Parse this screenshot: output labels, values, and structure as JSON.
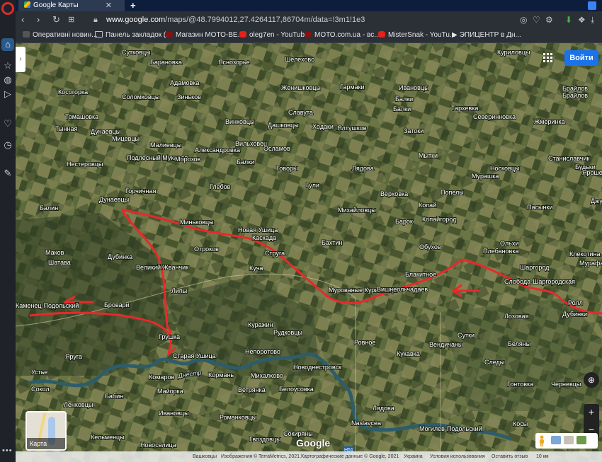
{
  "browser": {
    "tab_title": "Google Карты",
    "url_host": "www.google.com",
    "url_path": "/maps/@48.7994012,27.4264117,86704m/data=!3m1!1e3",
    "bookmarks": [
      {
        "label": "Оперативні новин...",
        "icon": "um"
      },
      {
        "label": "Панель закладок (...",
        "icon": "folder"
      },
      {
        "label": "Магазин МОТО-ВЕ...",
        "icon": "moto"
      },
      {
        "label": "oleg7en - YouTube",
        "icon": "yt"
      },
      {
        "label": "МОТО.com.ua - вс...",
        "icon": "moto"
      },
      {
        "label": "MisterSnak - YouTu...",
        "icon": "yt"
      },
      {
        "label": "ЭПИЦЕНТР в Дн...",
        "icon": "play"
      }
    ]
  },
  "map": {
    "signin_label": "Войти",
    "layers_label": "Карта",
    "google_logo": "Google",
    "places": [
      "Сутковцы",
      "Барановка",
      "Ясноз... ",
      "Шелехово",
      "Куриловцы",
      "Яснозорье",
      "Косогорка",
      "Адамовка",
      "Соломковцы",
      "Зиньков",
      "Гармаки",
      "Ивановцы",
      "Брайлов",
      "Томашовка",
      "Женишковцы",
      "Балки",
      "Тархевка",
      "Северинновка",
      "Брайлов",
      "Тынная",
      "Дунаевцы",
      "Винковцы",
      "Славута",
      "Ходаки",
      "Балки",
      "Затоки",
      "Жмеринка",
      "Мицевцы",
      "Малиевцы",
      "Дашковцы",
      "Ялтушков",
      "Станиславчик",
      "Нестеровцы",
      "Подлесный Мукаров",
      "Вильховец",
      "Александровка",
      "Осламов",
      "Мытки",
      "Будьки",
      "Морозов",
      "Балки",
      "Говоры",
      "Лядова",
      "Носковцы",
      "Ярошевка",
      "Горчичная",
      "Глебов",
      "Гули",
      "Мурашка",
      "Джурин",
      "Балин",
      "Дунаевцы",
      "Верховка",
      "Попелы",
      "Пасынки",
      "Миньковцы",
      "Михайловцы",
      "Копай",
      "Копайгород",
      "Новая Ушица",
      "Барок",
      "Каскада",
      "Бахтин",
      "Ольхи",
      "Плебановка",
      "Маков",
      "Отроков",
      "Струга",
      "Обухов",
      "Клекотина",
      "Шатава",
      "Дубинка",
      "Великий Жванчик",
      "Куча",
      "Шаргород",
      "Мурафа",
      "Липы",
      "Мурованые Куриловцы",
      "Вишнеольчадаев",
      "Блакитное",
      "Слобода-Шаргородская",
      "Каменец-Подольский",
      "Бровари",
      "Ролл",
      "Лозовая",
      "Дубинки",
      "Куражин",
      "Рудковцы",
      "Сутки",
      "Грушка",
      "Старая Ушица",
      "Непоротово",
      "Ровное",
      "Вендичаны",
      "Беляны",
      "Яруга",
      "Кукавка",
      "Устье",
      "Кормань",
      "Михалково",
      "Новоднестровск",
      "Следы",
      "Сокол",
      "Комаров",
      "Днестр",
      "Ветрянка",
      "Белоусовка",
      "Гонтовка",
      "Черневцы",
      "Майорка",
      "Ленковцы",
      "Бабин",
      "Лядова",
      "Ивановцы",
      "Романковцы",
      "Naslavcea",
      "Могилев-Подольский",
      "Косы",
      "Кельменцы",
      "Гвоздовцы",
      "Сокиряны",
      "Новоселица"
    ],
    "river_label": "Днестр",
    "footer": {
      "left": "Вашковцы",
      "attribution": "Изображения © TerraMetrics, 2021,Картографические данные © Google, 2021",
      "country": "Украина",
      "terms": "Условия использования",
      "feedback": "Оставить отзыв",
      "scale": "10 км"
    },
    "road_badge": "Н51"
  },
  "colors": {
    "route": "#e8292b",
    "satellite_dark": "#3f4f2a",
    "satellite_light": "#6f7a48",
    "river": "#2d5d6a"
  }
}
